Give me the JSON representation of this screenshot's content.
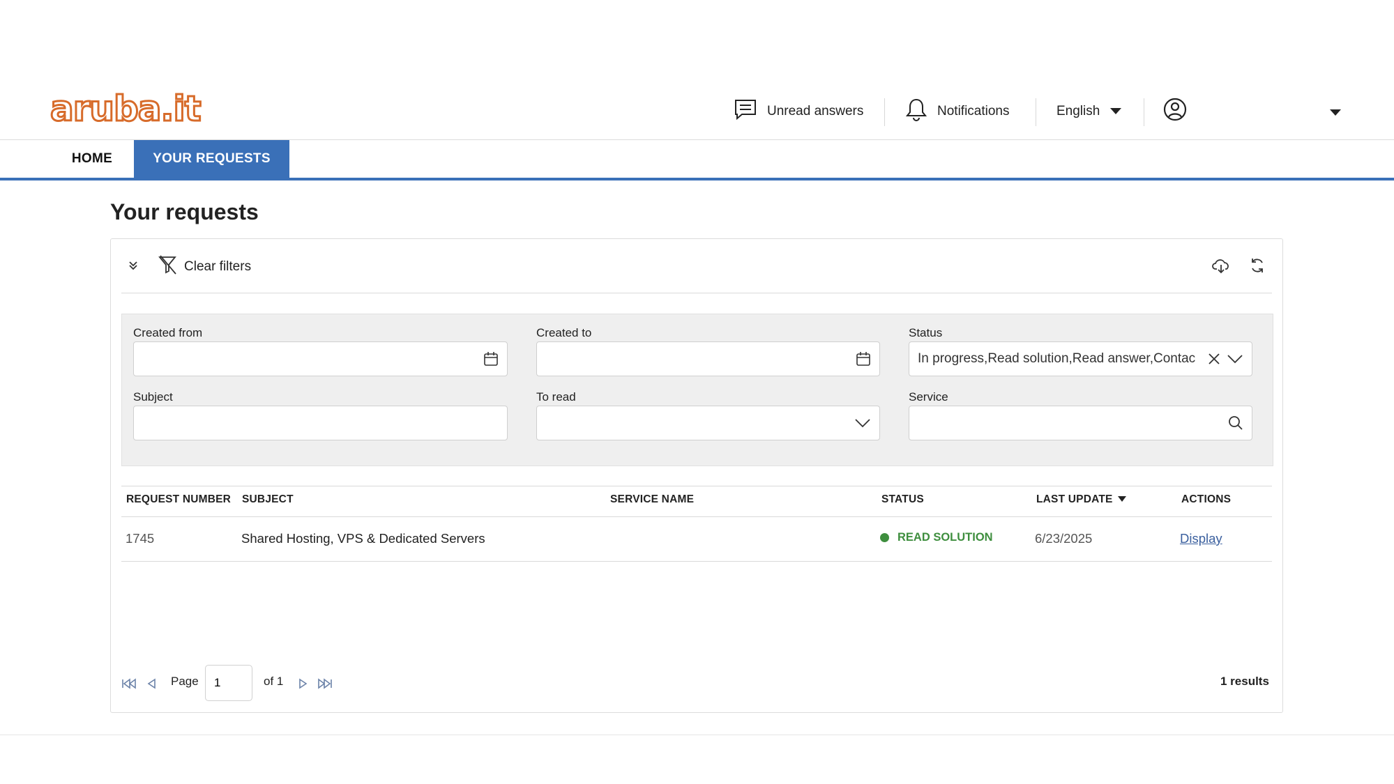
{
  "header": {
    "logo_text": "aruba.it",
    "unread_answers": "Unread answers",
    "notifications": "Notifications",
    "language": "English"
  },
  "nav": {
    "home": "HOME",
    "your_requests": "YOUR REQUESTS"
  },
  "page": {
    "title": "Your requests"
  },
  "toolbar": {
    "clear_filters": "Clear filters"
  },
  "filters": {
    "created_from": {
      "label": "Created from",
      "value": ""
    },
    "created_to": {
      "label": "Created to",
      "value": ""
    },
    "status": {
      "label": "Status",
      "value": "In progress,Read solution,Read answer,Contac"
    },
    "subject": {
      "label": "Subject",
      "value": ""
    },
    "to_read": {
      "label": "To read",
      "value": ""
    },
    "service": {
      "label": "Service",
      "value": ""
    }
  },
  "table": {
    "columns": [
      "REQUEST NUMBER",
      "SUBJECT",
      "SERVICE NAME",
      "STATUS",
      "LAST UPDATE",
      "ACTIONS"
    ],
    "rows": [
      {
        "request_number": "1745",
        "subject": "Shared Hosting, VPS & Dedicated Servers",
        "service_name": "",
        "status": "READ SOLUTION",
        "last_update": "6/23/2025",
        "action": "Display"
      }
    ]
  },
  "pagination": {
    "page_label": "Page",
    "current_page": "1",
    "of_label": "of 1",
    "results": "1 results"
  },
  "colors": {
    "brand_orange": "#d76b2a",
    "nav_blue": "#3a70b8",
    "status_green": "#3e8e3e",
    "link_blue": "#3a5f9e"
  }
}
